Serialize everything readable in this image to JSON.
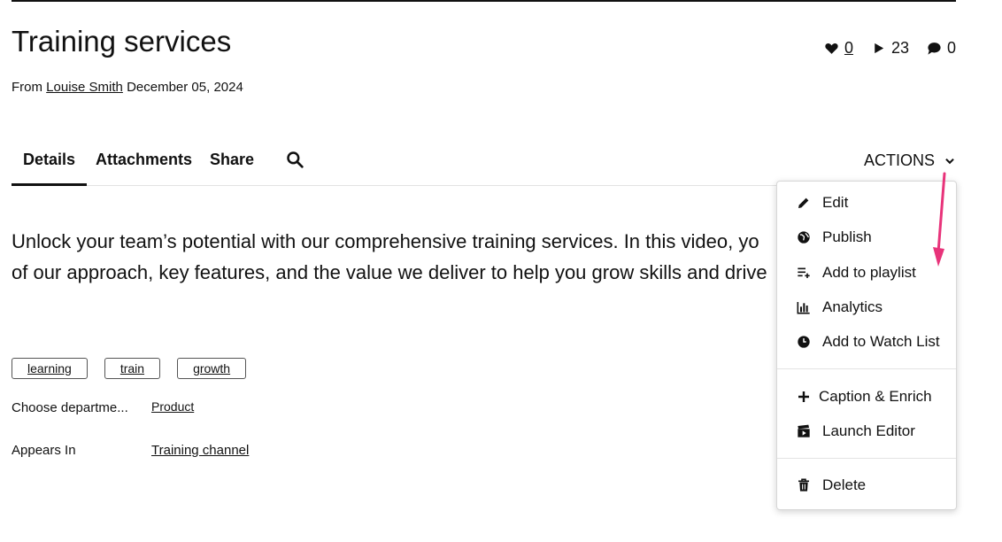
{
  "header": {
    "title": "Training services",
    "byline_prefix": "From",
    "author": "Louise Smith",
    "date": "December 05, 2024"
  },
  "stats": {
    "likes": "0",
    "plays": "23",
    "comments": "0"
  },
  "tabs": {
    "details": "Details",
    "attachments": "Attachments",
    "share": "Share"
  },
  "actions_label": "ACTIONS",
  "description": {
    "line1": "Unlock your team’s potential with our comprehensive training services. In this video, yo",
    "line2": "of our approach, key features, and the value we deliver to help you grow skills and drive"
  },
  "tags": [
    "learning",
    "train",
    "growth"
  ],
  "meta": {
    "department_label": "Choose departme...",
    "department_value": "Product",
    "appears_label": "Appears In",
    "appears_value": "Training channel"
  },
  "menu": {
    "edit": "Edit",
    "publish": "Publish",
    "add_to_playlist": "Add to playlist",
    "analytics": "Analytics",
    "add_to_watch_list": "Add to Watch List",
    "caption_enrich": "Caption & Enrich",
    "launch_editor": "Launch Editor",
    "delete": "Delete"
  },
  "colors": {
    "annotation_arrow": "#e8337a"
  },
  "icons": {
    "likes": "heart-icon",
    "plays": "play-icon",
    "comments": "comment-icon",
    "search": "search-icon",
    "actions": "chevron-down-icon",
    "edit": "pencil-icon",
    "publish": "globe-icon",
    "playlist": "playlist-add-icon",
    "analytics": "bar-chart-icon",
    "watch_list": "clock-icon",
    "caption": "plus-icon",
    "editor": "clapperboard-icon",
    "delete": "trash-icon"
  }
}
